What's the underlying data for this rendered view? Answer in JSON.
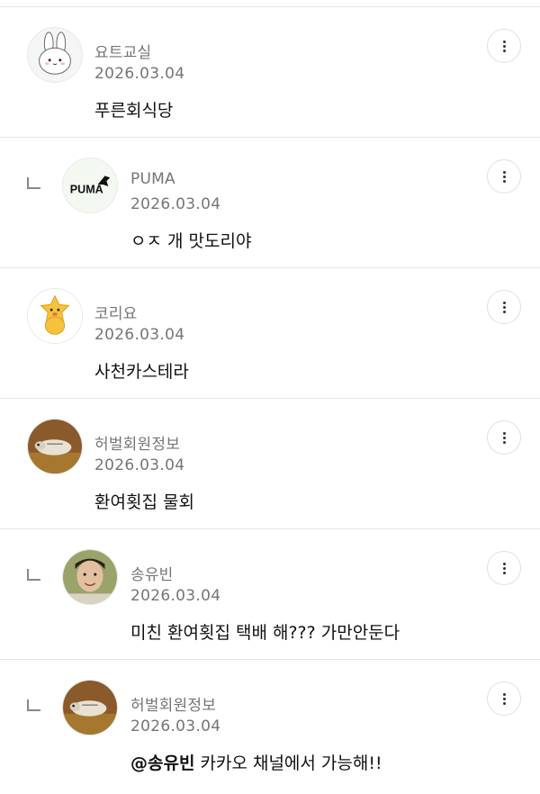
{
  "comments": [
    {
      "author": "요트교실",
      "date": "2026.03.04",
      "text": "푸른회식당",
      "mention": "",
      "avatar_icon": "bunny-avatar-icon"
    },
    {
      "author": "PUMA",
      "date": "2026.03.04",
      "text": "ㅇㅈ 개 맛도리야",
      "mention": "",
      "avatar_icon": "puma-logo-avatar-icon"
    },
    {
      "author": "코리요",
      "date": "2026.03.04",
      "text": "사천카스테라",
      "mention": "",
      "avatar_icon": "mascot-avatar-icon"
    },
    {
      "author": "허벌회원정보",
      "date": "2026.03.04",
      "text": "환여횟집 물회",
      "mention": "",
      "avatar_icon": "photo-avatar-icon"
    },
    {
      "author": "송유빈",
      "date": "2026.03.04",
      "text": "미친 환여횟집 택배 해??? 가만안둔다",
      "mention": "",
      "avatar_icon": "person-photo-avatar-icon"
    },
    {
      "author": "허벌회원정보",
      "date": "2026.03.04",
      "text": " 카카오 채널에서 가능해!!",
      "mention": "@송유빈",
      "avatar_icon": "photo-avatar-icon"
    }
  ],
  "icons": {
    "more": "more-vertical-icon",
    "reply": "reply-indent-icon"
  },
  "colors": {
    "meta_text": "#757575",
    "body_text": "#111111",
    "divider": "#e6e6e6"
  }
}
